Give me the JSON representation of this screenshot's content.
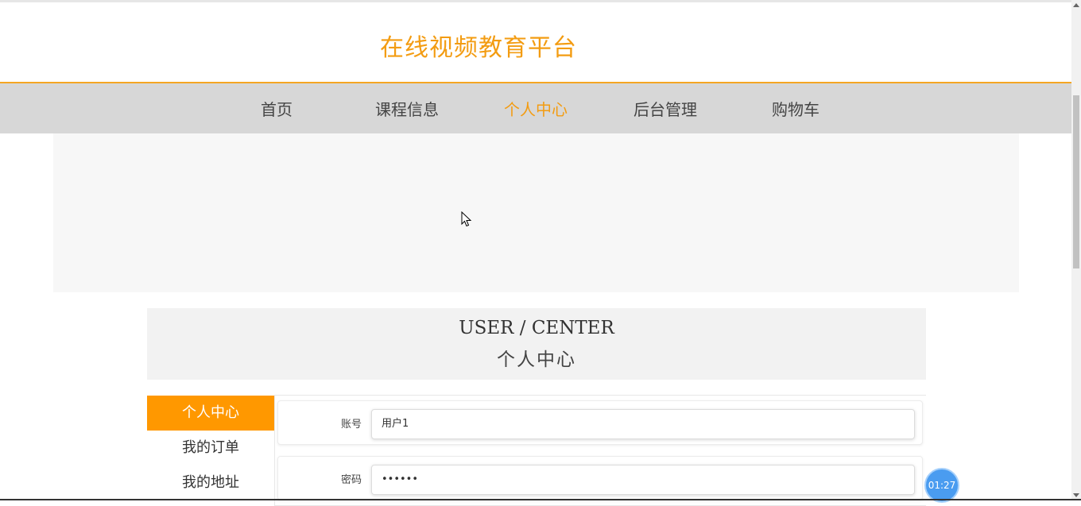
{
  "header": {
    "title": "在线视频教育平台"
  },
  "nav": {
    "items": [
      {
        "label": "首页"
      },
      {
        "label": "课程信息"
      },
      {
        "label": "个人中心"
      },
      {
        "label": "后台管理"
      },
      {
        "label": "购物车"
      }
    ],
    "active": "个人中心"
  },
  "section": {
    "title_en": "USER / CENTER",
    "title_cn": "个人中心"
  },
  "sidebar": {
    "items": [
      {
        "label": "个人中心"
      },
      {
        "label": "我的订单"
      },
      {
        "label": "我的地址"
      }
    ],
    "active": "个人中心"
  },
  "form": {
    "account_label": "账号",
    "account_value": "用户1",
    "password_label": "密码",
    "password_value": "••••••"
  },
  "timer": {
    "text": "01:27"
  },
  "colors": {
    "accent": "#f39c12",
    "nav_bg": "#d7d7d7",
    "sidebar_active": "#ff9800",
    "timer": "#4a9cf0"
  }
}
